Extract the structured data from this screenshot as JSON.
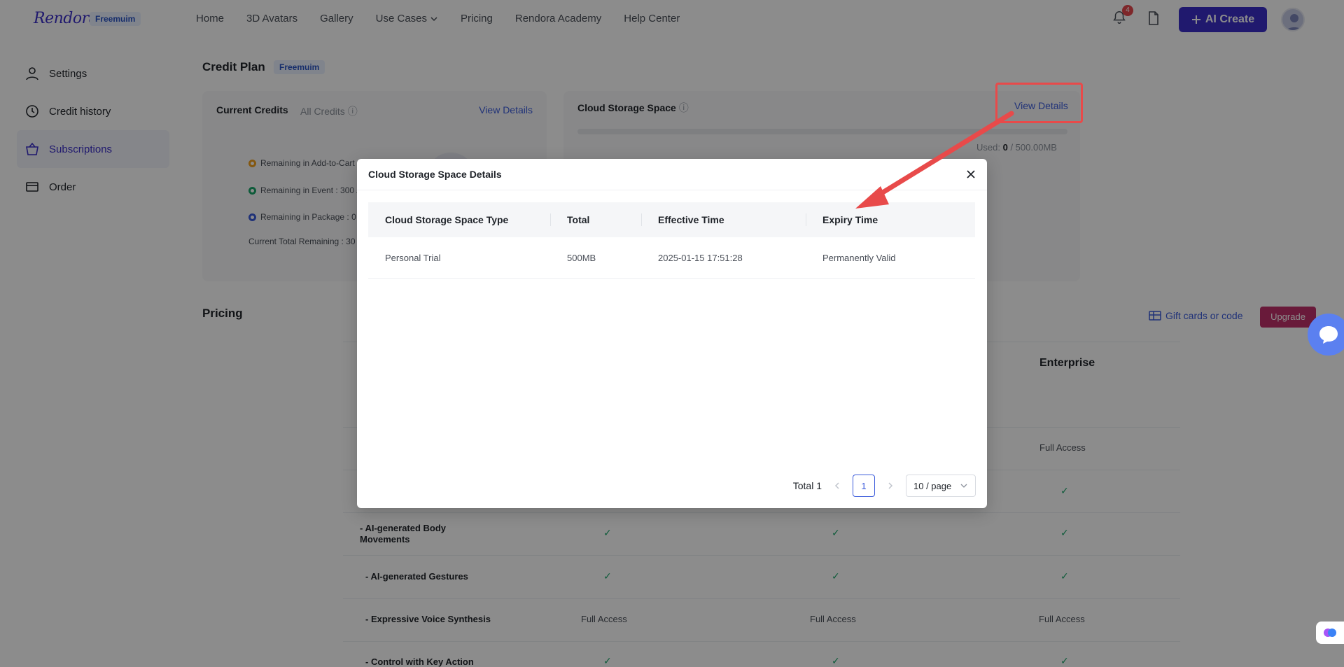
{
  "topbar": {
    "logo": "Rendora",
    "plan_chip": "Freemuim",
    "nav": [
      "Home",
      "3D Avatars",
      "Gallery",
      "Use Cases",
      "Pricing",
      "Rendora Academy",
      "Help Center"
    ],
    "notification_count": "4",
    "ai_create_label": "AI Create"
  },
  "sidebar": {
    "items": [
      {
        "label": "Settings"
      },
      {
        "label": "Credit history"
      },
      {
        "label": "Subscriptions"
      },
      {
        "label": "Order"
      }
    ]
  },
  "credit_plan": {
    "title": "Credit Plan",
    "chip": "Freemuim",
    "current_credits_tab": "Current Credits",
    "all_credits_tab": "All Credits",
    "view_details": "View Details",
    "legend": [
      {
        "label": "Remaining in Add-to-Cart",
        "color": "#f0a020"
      },
      {
        "label": "Remaining in Event : 300 /",
        "color": "#1aa76a"
      },
      {
        "label": "Remaining in Package : 0 /",
        "color": "#3b5bdb"
      }
    ],
    "total_remaining": "Current Total Remaining : 30"
  },
  "cloud_storage": {
    "title": "Cloud Storage Space",
    "view_details": "View Details",
    "used_label": "Used:",
    "used_value": "0",
    "total_value": "/ 500.00MB"
  },
  "pricing": {
    "title": "Pricing",
    "gift_cards": "Gift cards or code",
    "upgrade": "Upgrade",
    "enterprise": "Enterprise",
    "full_access": "Full Access",
    "rows": [
      {
        "label": "- AI-generated Body Movements"
      },
      {
        "label": "- AI-generated Gestures"
      },
      {
        "label": "- Expressive Voice Synthesis"
      },
      {
        "label": "- Control with Key Action"
      }
    ]
  },
  "modal": {
    "title": "Cloud Storage Space Details",
    "columns": [
      "Cloud Storage Space Type",
      "Total",
      "Effective Time",
      "Expiry Time"
    ],
    "rows": [
      [
        "Personal Trial",
        "500MB",
        "2025-01-15 17:51:28",
        "Permanently Valid"
      ]
    ],
    "total_label": "Total 1",
    "current_page": "1",
    "page_size": "10 / page"
  },
  "colors": {
    "accent": "#3b2fc9",
    "link": "#3b5bdb",
    "annotation": "#e84a4a",
    "success": "#1aa76a"
  }
}
